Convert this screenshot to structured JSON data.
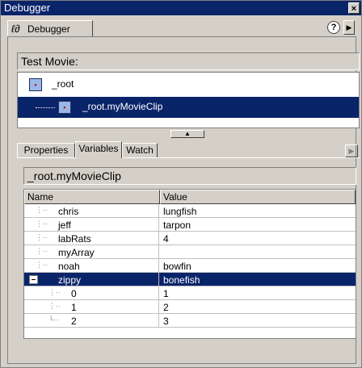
{
  "window": {
    "title": "Debugger",
    "close_glyph": "×"
  },
  "panel": {
    "tab_label": "Debugger",
    "tab_icon": "bug-icon",
    "help_glyph": "?",
    "menu_arrow_glyph": "▶"
  },
  "movie": {
    "label": "Test Movie:"
  },
  "tree": {
    "items": [
      {
        "label": "_root",
        "selected": false,
        "icon": "movieclip-icon"
      },
      {
        "label": "_root.myMovieClip",
        "selected": true,
        "icon": "movieclip-icon"
      }
    ]
  },
  "splitter": {
    "glyph": "▲"
  },
  "tabs": {
    "items": [
      {
        "label": "Properties",
        "active": false
      },
      {
        "label": "Variables",
        "active": true
      },
      {
        "label": "Watch",
        "active": false
      }
    ],
    "scroll_glyph": "▶"
  },
  "target": {
    "path": "_root.myMovieClip"
  },
  "grid": {
    "columns": [
      "Name",
      "Value"
    ],
    "rows": [
      {
        "name": "chris",
        "value": "lungfish",
        "level": 0,
        "expander": false,
        "selected": false
      },
      {
        "name": "jeff",
        "value": "tarpon",
        "level": 0,
        "expander": false,
        "selected": false
      },
      {
        "name": "labRats",
        "value": "4",
        "level": 0,
        "expander": false,
        "selected": false
      },
      {
        "name": "myArray",
        "value": "",
        "level": 0,
        "expander": false,
        "selected": false
      },
      {
        "name": "noah",
        "value": "bowfin",
        "level": 0,
        "expander": false,
        "selected": false
      },
      {
        "name": "zippy",
        "value": "bonefish",
        "level": 0,
        "expander": true,
        "selected": true
      },
      {
        "name": "0",
        "value": "1",
        "level": 1,
        "expander": false,
        "selected": false
      },
      {
        "name": "1",
        "value": "2",
        "level": 1,
        "expander": false,
        "selected": false
      },
      {
        "name": "2",
        "value": "3",
        "level": 1,
        "expander": false,
        "selected": false
      }
    ]
  },
  "colors": {
    "selection": "#0a246a",
    "titlebar": "#0a246a",
    "face": "#d4d0c8"
  }
}
